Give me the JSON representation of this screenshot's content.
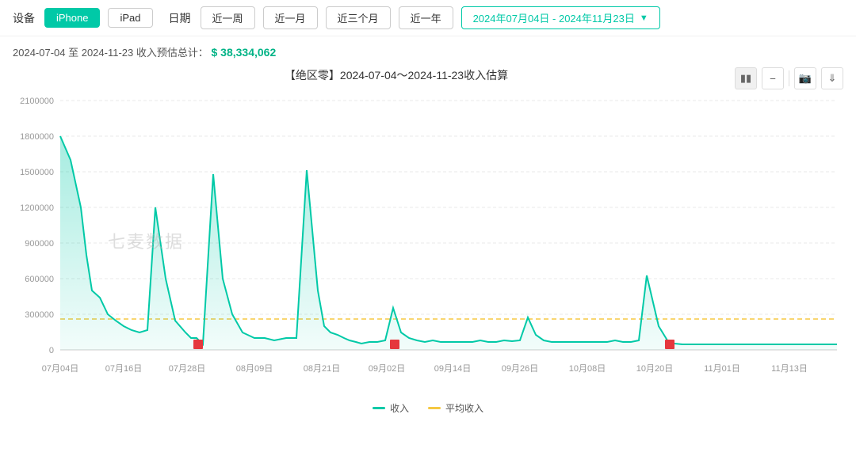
{
  "toolbar": {
    "device_label": "设备",
    "iphone_label": "iPhone",
    "ipad_label": "iPad",
    "date_label": "日期",
    "week_label": "近一周",
    "month_label": "近一月",
    "three_month_label": "近三个月",
    "year_label": "近一年",
    "date_range_label": "2024年07月04日 - 2024年11月23日",
    "chevron": "▼"
  },
  "summary": {
    "text": "2024-07-04 至 2024-11-23 收入预估总计：",
    "amount": "$ 38,334,062"
  },
  "chart": {
    "title": "【绝区零】2024-07-04～2024-11-23收入估算",
    "y_labels": [
      "2100000",
      "1800000",
      "1500000",
      "1200000",
      "900000",
      "600000",
      "300000",
      "0"
    ],
    "x_labels": [
      "07月04日",
      "07月16日",
      "07月28日",
      "08月09日",
      "08月21日",
      "09月02日",
      "09月14日",
      "09月26日",
      "10月08日",
      "10月20日",
      "11月01日",
      "11月13日"
    ]
  },
  "legend": {
    "revenue_label": "收入",
    "avg_label": "平均收入"
  },
  "colors": {
    "teal": "#00c9a7",
    "orange": "#f5a623",
    "red": "#e5373d",
    "avg_line": "#f5c842"
  },
  "watermark": "七麦数据"
}
